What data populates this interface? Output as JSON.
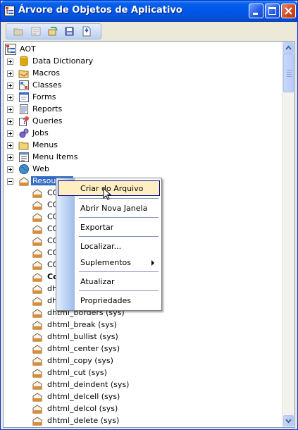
{
  "window": {
    "title": "Árvore de Objetos de Aplicativo"
  },
  "tree": {
    "root": "AOT",
    "nodes": [
      {
        "label": "Data Dictionary",
        "icon": "database-icon"
      },
      {
        "label": "Macros",
        "icon": "macros-folder-icon"
      },
      {
        "label": "Classes",
        "icon": "classes-icon"
      },
      {
        "label": "Forms",
        "icon": "forms-icon"
      },
      {
        "label": "Reports",
        "icon": "reports-icon"
      },
      {
        "label": "Queries",
        "icon": "queries-icon"
      },
      {
        "label": "Jobs",
        "icon": "jobs-icon"
      },
      {
        "label": "Menus",
        "icon": "menus-folder-icon"
      },
      {
        "label": "Menu Items",
        "icon": "menu-items-icon"
      },
      {
        "label": "Web",
        "icon": "web-globe-icon"
      },
      {
        "label": "Resources",
        "icon": "resources-icon"
      }
    ],
    "resources": [
      "CO",
      "CO",
      "CO",
      "CO",
      "CO",
      "CO",
      "CO",
      "Co",
      "dht",
      "dht",
      "dhtml_borders (sys)",
      "dhtml_break (sys)",
      "dhtml_bullist (sys)",
      "dhtml_center (sys)",
      "dhtml_copy (sys)",
      "dhtml_cut (sys)",
      "dhtml_deindent (sys)",
      "dhtml_delcell (sys)",
      "dhtml_delcol (sys)",
      "dhtml_delete (sys)"
    ]
  },
  "context_menu": {
    "items": [
      {
        "label": "Criar do Arquivo",
        "highlighted": true
      },
      {
        "label": "Abrir Nova Janela"
      },
      {
        "label": "Exportar"
      },
      {
        "label": "Localizar..."
      },
      {
        "label": "Suplementos",
        "submenu": true
      },
      {
        "label": "Atualizar"
      },
      {
        "label": "Propriedades"
      }
    ]
  },
  "colors": {
    "selection": "#316ac5",
    "menu_highlight": "#ffeec2",
    "titlebar": "#0058ee"
  }
}
